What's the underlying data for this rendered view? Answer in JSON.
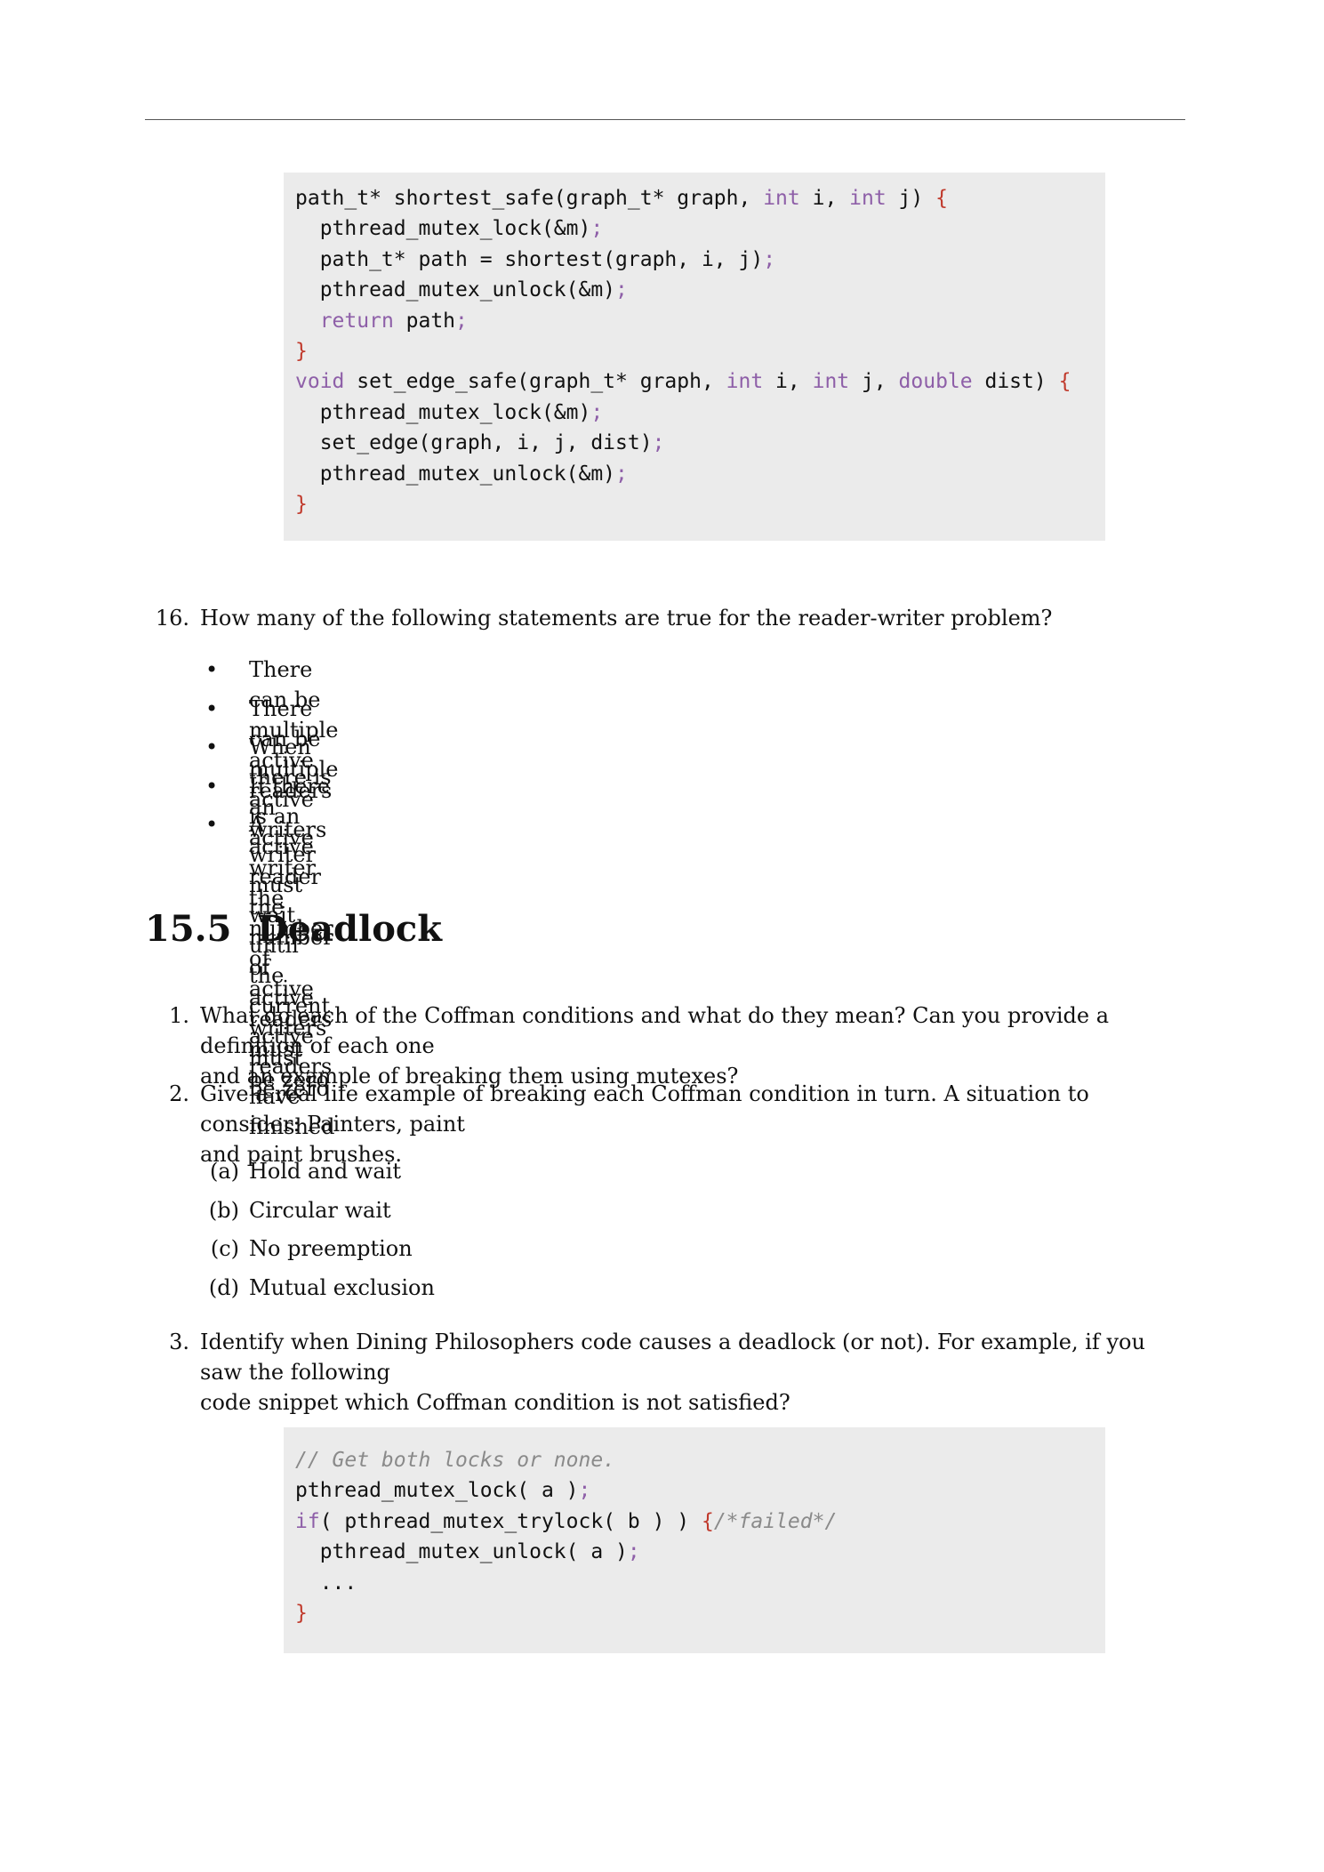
{
  "code1": [
    [
      {
        "t": "path_t* shortest_safe(graph_t* graph, ",
        "c": ""
      },
      {
        "t": "int",
        "c": "kw"
      },
      {
        "t": " i, ",
        "c": ""
      },
      {
        "t": "int",
        "c": "kw"
      },
      {
        "t": " j) ",
        "c": ""
      },
      {
        "t": "{",
        "c": "br"
      }
    ],
    [
      {
        "t": "  pthread_mutex_lock(&m)",
        "c": ""
      },
      {
        "t": ";",
        "c": "sc"
      }
    ],
    [
      {
        "t": "  path_t* path = shortest(graph, i, j)",
        "c": ""
      },
      {
        "t": ";",
        "c": "sc"
      }
    ],
    [
      {
        "t": "  pthread_mutex_unlock(&m)",
        "c": ""
      },
      {
        "t": ";",
        "c": "sc"
      }
    ],
    [
      {
        "t": "  ",
        "c": ""
      },
      {
        "t": "return",
        "c": "kw"
      },
      {
        "t": " path",
        "c": ""
      },
      {
        "t": ";",
        "c": "sc"
      }
    ],
    [
      {
        "t": "}",
        "c": "br"
      }
    ],
    [
      {
        "t": "void",
        "c": "kw"
      },
      {
        "t": " set_edge_safe(graph_t* graph, ",
        "c": ""
      },
      {
        "t": "int",
        "c": "kw"
      },
      {
        "t": " i, ",
        "c": ""
      },
      {
        "t": "int",
        "c": "kw"
      },
      {
        "t": " j, ",
        "c": ""
      },
      {
        "t": "double",
        "c": "kw"
      },
      {
        "t": " dist) ",
        "c": ""
      },
      {
        "t": "{",
        "c": "br"
      }
    ],
    [
      {
        "t": "  pthread_mutex_lock(&m)",
        "c": ""
      },
      {
        "t": ";",
        "c": "sc"
      }
    ],
    [
      {
        "t": "  set_edge(graph, i, j, dist)",
        "c": ""
      },
      {
        "t": ";",
        "c": "sc"
      }
    ],
    [
      {
        "t": "  pthread_mutex_unlock(&m)",
        "c": ""
      },
      {
        "t": ";",
        "c": "sc"
      }
    ],
    [
      {
        "t": "}",
        "c": "br"
      }
    ]
  ],
  "q16": {
    "number": "16.",
    "text": "How many of the following statements are true for the reader-writer problem?",
    "bullet": "•",
    "items": [
      "There can be multiple active readers",
      "There can be multiple active writers",
      "When there is an active writer the number of active readers must be zero",
      "If there is an active reader the number of active writers must be zero",
      "A writer must wait until the current active readers have finished"
    ]
  },
  "section": {
    "number": "15.5",
    "title": "Deadlock"
  },
  "q1": {
    "number": "1.",
    "line1": "What do each of the Coffman conditions and what do they mean? Can you provide a definition of each one",
    "line2": "and an example of breaking them using mutexes?"
  },
  "q2": {
    "number": "2.",
    "line1": "Give a real life example of breaking each Coffman condition in turn. A situation to consider: Painters, paint",
    "line2": "and paint brushes.",
    "items": [
      {
        "tag": "(a)",
        "label": "Hold and wait"
      },
      {
        "tag": "(b)",
        "label": "Circular wait"
      },
      {
        "tag": "(c)",
        "label": "No preemption"
      },
      {
        "tag": "(d)",
        "label": "Mutual exclusion"
      }
    ]
  },
  "q3": {
    "number": "3.",
    "line1": "Identify when Dining Philosophers code causes a deadlock (or not). For example, if you saw the following",
    "line2": "code snippet which Coffman condition is not satisfied?"
  },
  "code2": [
    [
      {
        "t": "// Get both locks or none.",
        "c": "cm"
      }
    ],
    [
      {
        "t": "pthread_mutex_lock( a )",
        "c": ""
      },
      {
        "t": ";",
        "c": "sc"
      }
    ],
    [
      {
        "t": "if",
        "c": "kw"
      },
      {
        "t": "( pthread_mutex_trylock( b ) ) ",
        "c": ""
      },
      {
        "t": "{",
        "c": "br"
      },
      {
        "t": "/*failed*/",
        "c": "cm"
      }
    ],
    [
      {
        "t": "  pthread_mutex_unlock( a )",
        "c": ""
      },
      {
        "t": ";",
        "c": "sc"
      }
    ],
    [
      {
        "t": "  ...",
        "c": ""
      }
    ],
    [
      {
        "t": "}",
        "c": "br"
      }
    ]
  ]
}
